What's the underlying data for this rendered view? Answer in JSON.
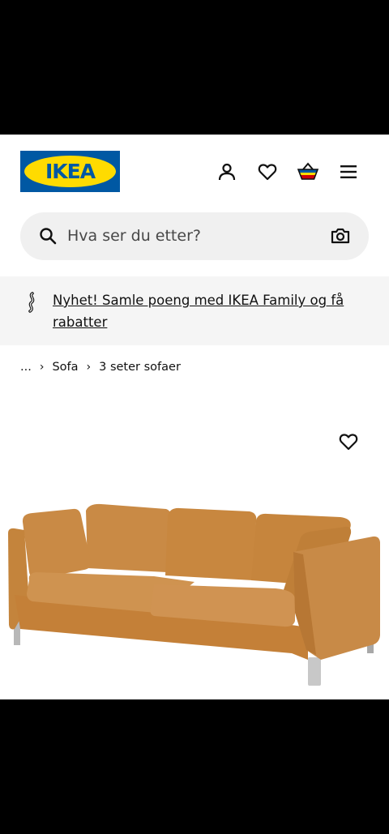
{
  "header": {
    "logo_text": "IKEA",
    "icons": [
      "person-icon",
      "heart-icon",
      "basket-icon",
      "hamburger-menu-icon"
    ]
  },
  "search": {
    "placeholder": "Hva ser du etter?",
    "icons": [
      "search-icon",
      "camera-icon"
    ]
  },
  "promo": {
    "text": "Nyhet! Samle poeng med IKEA Family og få rabatter",
    "icon": "ikea-family-icon"
  },
  "breadcrumb": {
    "items": [
      "...",
      "Sofa",
      "3 seter sofaer"
    ]
  },
  "product": {
    "image": "tan-leather-3-seat-sofa",
    "favourite_icon": "heart-icon"
  },
  "colors": {
    "brand_blue": "#0058a3",
    "brand_yellow": "#ffdb00",
    "sofa_leather": "#c9883f"
  }
}
